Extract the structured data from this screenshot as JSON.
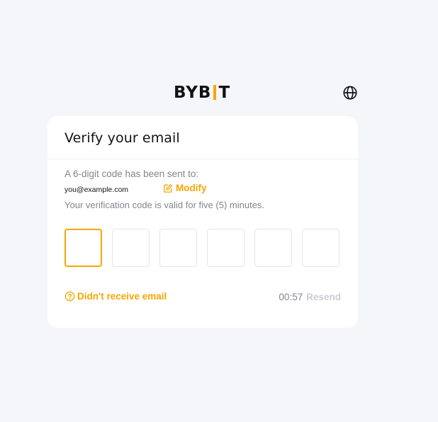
{
  "header": {
    "logo_text_1": "BYB",
    "logo_text_2": "T",
    "language_icon": "globe-icon"
  },
  "verify": {
    "title": "Verify your email",
    "sent_text": "A 6-digit code has been sent to:",
    "email": "you@example.com",
    "modify_label": "Modify",
    "modify_icon": "edit-icon",
    "valid_text": "Your verification code is valid for five (5) minutes.",
    "code_digits": [
      "",
      "",
      "",
      "",
      "",
      ""
    ],
    "active_index": 0,
    "not_received_label": "Didn't receive email",
    "not_received_icon": "question-circle-icon",
    "timer": "00:57",
    "resend_label": "Resend"
  },
  "colors": {
    "accent": "#f7a600",
    "background": "#f5f6fa",
    "text_primary": "#121214",
    "text_secondary": "#81858c",
    "disabled": "#c9cdd4"
  }
}
